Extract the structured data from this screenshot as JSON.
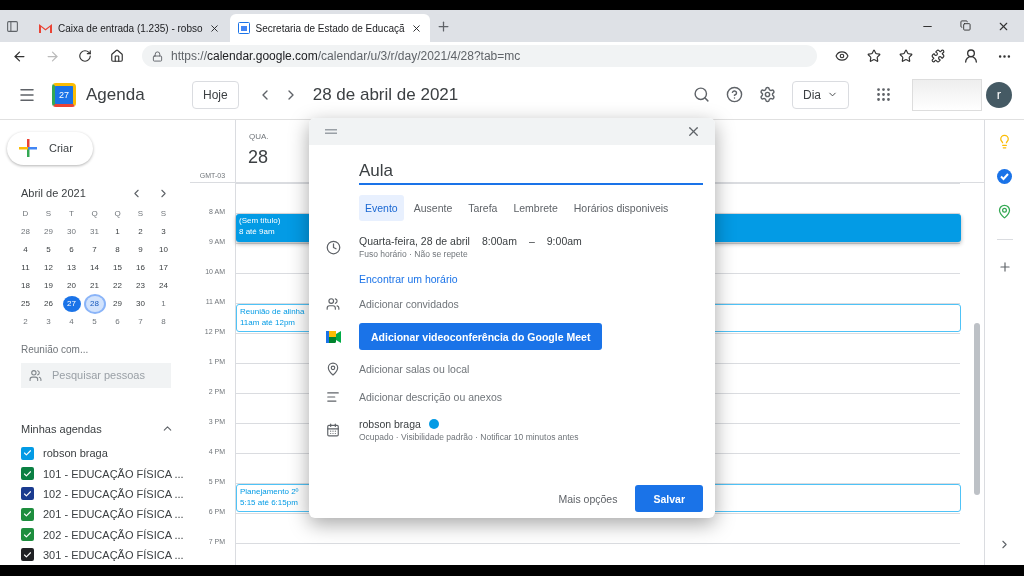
{
  "browser": {
    "tabs": [
      {
        "label": "Caixa de entrada (1.235) - robso",
        "selected": false,
        "kind": "mail"
      },
      {
        "label": "Secretaria de Estado de Educaçã",
        "selected": true,
        "kind": "calendar"
      }
    ],
    "address": {
      "prefix": "https://",
      "host": "calendar.google.com",
      "path": "/calendar/u/3/r/day/2021/4/28?tab=mc"
    }
  },
  "header": {
    "logo_day": "27",
    "app_name": "Agenda",
    "today_button": "Hoje",
    "date_title": "28 de abril de 2021",
    "view_select": "Dia",
    "avatar_letter": "r"
  },
  "create_button": "Criar",
  "mini_calendar": {
    "title": "Abril de 2021",
    "weekdays": [
      "D",
      "S",
      "T",
      "Q",
      "Q",
      "S",
      "S"
    ],
    "weeks": [
      [
        {
          "day": "28",
          "in_month": false,
          "today": false,
          "selected": false
        },
        {
          "day": "29",
          "in_month": false,
          "today": false,
          "selected": false
        },
        {
          "day": "30",
          "in_month": false,
          "today": false,
          "selected": false
        },
        {
          "day": "31",
          "in_month": false,
          "today": false,
          "selected": false
        },
        {
          "day": "1",
          "in_month": true,
          "today": false,
          "selected": false
        },
        {
          "day": "2",
          "in_month": true,
          "today": false,
          "selected": false
        },
        {
          "day": "3",
          "in_month": true,
          "today": false,
          "selected": false
        }
      ],
      [
        {
          "day": "4",
          "in_month": true,
          "today": false,
          "selected": false
        },
        {
          "day": "5",
          "in_month": true,
          "today": false,
          "selected": false
        },
        {
          "day": "6",
          "in_month": true,
          "today": false,
          "selected": false
        },
        {
          "day": "7",
          "in_month": true,
          "today": false,
          "selected": false
        },
        {
          "day": "8",
          "in_month": true,
          "today": false,
          "selected": false
        },
        {
          "day": "9",
          "in_month": true,
          "today": false,
          "selected": false
        },
        {
          "day": "10",
          "in_month": true,
          "today": false,
          "selected": false
        }
      ],
      [
        {
          "day": "11",
          "in_month": true,
          "today": false,
          "selected": false
        },
        {
          "day": "12",
          "in_month": true,
          "today": false,
          "selected": false
        },
        {
          "day": "13",
          "in_month": true,
          "today": false,
          "selected": false
        },
        {
          "day": "14",
          "in_month": true,
          "today": false,
          "selected": false
        },
        {
          "day": "15",
          "in_month": true,
          "today": false,
          "selected": false
        },
        {
          "day": "16",
          "in_month": true,
          "today": false,
          "selected": false
        },
        {
          "day": "17",
          "in_month": true,
          "today": false,
          "selected": false
        }
      ],
      [
        {
          "day": "18",
          "in_month": true,
          "today": false,
          "selected": false
        },
        {
          "day": "19",
          "in_month": true,
          "today": false,
          "selected": false
        },
        {
          "day": "20",
          "in_month": true,
          "today": false,
          "selected": false
        },
        {
          "day": "21",
          "in_month": true,
          "today": false,
          "selected": false
        },
        {
          "day": "22",
          "in_month": true,
          "today": false,
          "selected": false
        },
        {
          "day": "23",
          "in_month": true,
          "today": false,
          "selected": false
        },
        {
          "day": "24",
          "in_month": true,
          "today": false,
          "selected": false
        }
      ],
      [
        {
          "day": "25",
          "in_month": true,
          "today": false,
          "selected": false
        },
        {
          "day": "26",
          "in_month": true,
          "today": false,
          "selected": false
        },
        {
          "day": "27",
          "in_month": true,
          "today": true,
          "selected": false
        },
        {
          "day": "28",
          "in_month": true,
          "today": false,
          "selected": true
        },
        {
          "day": "29",
          "in_month": true,
          "today": false,
          "selected": false
        },
        {
          "day": "30",
          "in_month": true,
          "today": false,
          "selected": false
        },
        {
          "day": "1",
          "in_month": false,
          "today": false,
          "selected": false
        }
      ],
      [
        {
          "day": "2",
          "in_month": false,
          "today": false,
          "selected": false
        },
        {
          "day": "3",
          "in_month": false,
          "today": false,
          "selected": false
        },
        {
          "day": "4",
          "in_month": false,
          "today": false,
          "selected": false
        },
        {
          "day": "5",
          "in_month": false,
          "today": false,
          "selected": false
        },
        {
          "day": "6",
          "in_month": false,
          "today": false,
          "selected": false
        },
        {
          "day": "7",
          "in_month": false,
          "today": false,
          "selected": false
        },
        {
          "day": "8",
          "in_month": false,
          "today": false,
          "selected": false
        }
      ]
    ]
  },
  "meet_with": {
    "title": "Reunião com...",
    "placeholder": "Pesquisar pessoas"
  },
  "my_calendars": {
    "title": "Minhas agendas",
    "expanded": true,
    "items": [
      {
        "name": "robson braga",
        "color": "#039be5",
        "checked": true
      },
      {
        "name": "101 - EDUCAÇÃO FÍSICA ...",
        "color": "#0b8043",
        "checked": true
      },
      {
        "name": "102 - EDUCAÇÃO FÍSICA ...",
        "color": "#1a3b8f",
        "checked": true
      },
      {
        "name": "201 - EDUCAÇÃO FÍSICA ...",
        "color": "#1e8e3e",
        "checked": true
      },
      {
        "name": "202 - EDUCAÇÃO FÍSICA ...",
        "color": "#1e8e3e",
        "checked": true
      },
      {
        "name": "301 - EDUCAÇÃO FÍSICA ...",
        "color": "#202124",
        "checked": true
      }
    ]
  },
  "day_view": {
    "weekday": "QUA.",
    "day": "28",
    "timezone": "GMT-03",
    "hours": [
      {
        "label": "8 AM",
        "events": [
          {
            "title": "(Sem título)",
            "time": "8 até 9am",
            "kind": "draft"
          }
        ]
      },
      {
        "label": "9 AM"
      },
      {
        "label": "10 AM"
      },
      {
        "label": "11 AM",
        "events": [
          {
            "title": "Reunião de alinha",
            "time": "11am até 12pm",
            "kind": "outline"
          }
        ]
      },
      {
        "label": "12 PM"
      },
      {
        "label": "1 PM"
      },
      {
        "label": "2 PM"
      },
      {
        "label": "3 PM"
      },
      {
        "label": "4 PM"
      },
      {
        "label": "5 PM",
        "events": [
          {
            "title": "Planejamento 2º",
            "time": "5:15 até 6:15pm",
            "kind": "outline"
          }
        ]
      },
      {
        "label": "6 PM"
      },
      {
        "label": "7 PM"
      }
    ]
  },
  "dialog": {
    "title_value": "Aula",
    "types": [
      {
        "label": "Evento",
        "selected": true
      },
      {
        "label": "Ausente",
        "selected": false
      },
      {
        "label": "Tarefa",
        "selected": false
      },
      {
        "label": "Lembrete",
        "selected": false
      },
      {
        "label": "Horários disponiveis",
        "selected": false
      }
    ],
    "date": "Quarta-feira, 28 de abril",
    "start": "8:00am",
    "dash": "–",
    "end": "9:00am",
    "subline": "Fuso horário · Não se repete",
    "find_time": "Encontrar um horário",
    "guests": "Adicionar convidados",
    "meet_button": "Adicionar videoconferência do Google Meet",
    "location": "Adicionar salas ou local",
    "description": "Adicionar descrição ou anexos",
    "calendar": {
      "name": "robson braga",
      "color": "#039be5",
      "details": "Ocupado · Visibilidade padrão · Notificar 10 minutos antes"
    },
    "more_options": "Mais opções",
    "save": "Salvar"
  }
}
